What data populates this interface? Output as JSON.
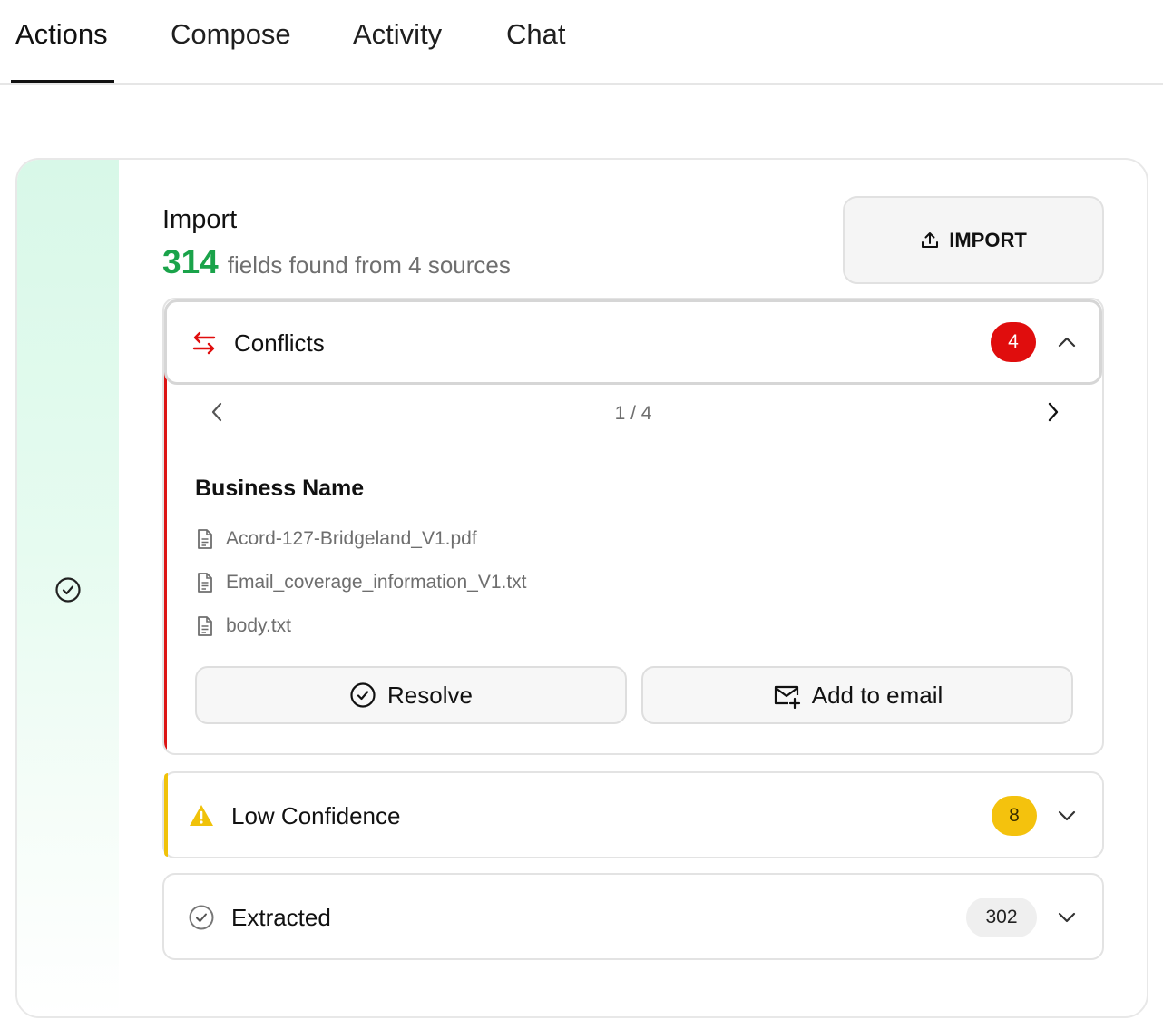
{
  "tabs": [
    {
      "label": "Actions",
      "active": true
    },
    {
      "label": "Compose",
      "active": false
    },
    {
      "label": "Activity",
      "active": false
    },
    {
      "label": "Chat",
      "active": false
    }
  ],
  "import": {
    "title": "Import",
    "field_count": "314",
    "summary": "fields found from 4 sources",
    "button_label": "IMPORT"
  },
  "conflicts": {
    "title": "Conflicts",
    "count": "4",
    "pager": "1 / 4",
    "field_name": "Business Name",
    "sources": [
      "Acord-127-Bridgeland_V1.pdf",
      "Email_coverage_information_V1.txt",
      "body.txt"
    ],
    "resolve_label": "Resolve",
    "add_email_label": "Add to email"
  },
  "low_confidence": {
    "title": "Low Confidence",
    "count": "8"
  },
  "extracted": {
    "title": "Extracted",
    "count": "302"
  },
  "colors": {
    "accent_green": "#1aa34a",
    "conflict_red": "#e00d0d",
    "warning_yellow": "#f4c20d"
  },
  "icons": {
    "import": "upload-icon",
    "conflicts": "swap-arrows-icon",
    "low_confidence": "warning-icon",
    "extracted": "check-circle-icon",
    "resolve": "check-circle-icon",
    "add_email": "mail-plus-icon",
    "source": "document-icon"
  }
}
